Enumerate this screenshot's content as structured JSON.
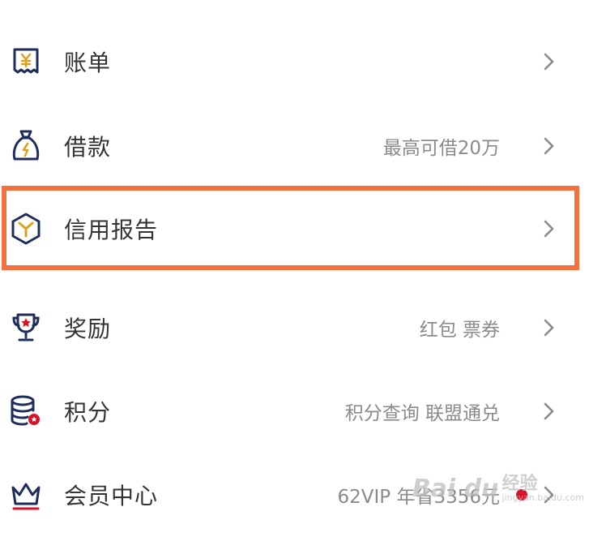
{
  "menu": {
    "items": [
      {
        "label": "账单",
        "subtitle": "",
        "icon": "bill-icon"
      },
      {
        "label": "借款",
        "subtitle": "最高可借20万",
        "icon": "loan-bag-icon"
      },
      {
        "label": "信用报告",
        "subtitle": "",
        "icon": "credit-report-icon"
      },
      {
        "label": "奖励",
        "subtitle": "红包 票券",
        "icon": "trophy-icon"
      },
      {
        "label": "积分",
        "subtitle": "积分查询 联盟通兑",
        "icon": "coins-icon"
      },
      {
        "label": "会员中心",
        "subtitle": "62VIP 年省3356元",
        "icon": "crown-icon"
      }
    ]
  },
  "colors": {
    "highlight": "#f4703f",
    "icon_navy": "#1f2d5c",
    "icon_gold": "#d8a323",
    "badge_red": "#d6132b"
  },
  "watermark": {
    "logo": "Bai du",
    "label": "经验",
    "url": "jingyan.baidu.com"
  }
}
